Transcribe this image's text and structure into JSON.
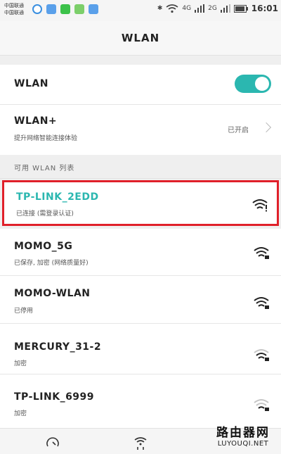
{
  "status_bar": {
    "carrier_line1": "中国联通",
    "carrier_line2": "中国联通",
    "network_4g": "4G",
    "network_2g": "2G",
    "time": "16:01",
    "notification_icons": [
      "browser-icon",
      "gallery-icon",
      "wechat-icon",
      "app-icon",
      "mail-icon"
    ]
  },
  "header": {
    "title": "WLAN"
  },
  "settings": {
    "wlan": {
      "label": "WLAN",
      "toggle_on": true
    },
    "wlan_plus": {
      "label": "WLAN+",
      "description": "提升网络智能连接体验",
      "state": "已开启"
    }
  },
  "section": {
    "available_title": "可用 WLAN 列表"
  },
  "networks": [
    {
      "ssid": "TP-LINK_2EDD",
      "status": "已连接 (需登录认证)",
      "connected": true,
      "signal": "full-warning"
    },
    {
      "ssid": "MOMO_5G",
      "status": "已保存, 加密 (网络质量好)",
      "connected": false,
      "signal": "full-locked"
    },
    {
      "ssid": "MOMO-WLAN",
      "status": "已停用",
      "connected": false,
      "signal": "full-locked"
    },
    {
      "ssid": "MERCURY_31-2",
      "status": "加密",
      "connected": false,
      "signal": "medium-locked"
    },
    {
      "ssid": "TP-LINK_6999",
      "status": "加密",
      "connected": false,
      "signal": "weak-locked"
    }
  ],
  "watermark": {
    "cn": "路由器网",
    "en": "LUYOUQI.NET"
  },
  "colors": {
    "accent": "#2bb7b0",
    "highlight_border": "#e0202a"
  }
}
